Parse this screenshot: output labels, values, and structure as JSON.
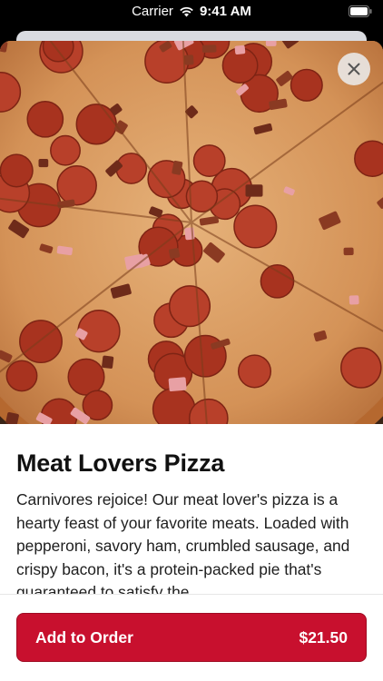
{
  "status_bar": {
    "carrier": "Carrier",
    "time": "9:41 AM"
  },
  "item": {
    "title": "Meat Lovers Pizza",
    "description": "Carnivores rejoice! Our meat lover's pizza is a hearty feast of your favorite meats. Loaded with pepperoni, savory ham, crumbled sausage, and crispy bacon, it's a protein-packed pie that's guaranteed to satisfy the",
    "image_icon": "pizza-photo"
  },
  "actions": {
    "close_icon": "close-icon",
    "add_label": "Add to Order",
    "price": "$21.50"
  },
  "colors": {
    "accent": "#c8102e"
  }
}
